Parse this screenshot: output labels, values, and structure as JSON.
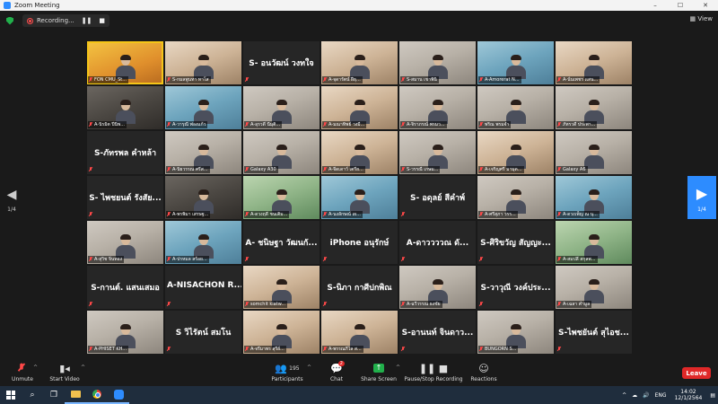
{
  "window": {
    "title": "Zoom Meeting",
    "controls": [
      "–",
      "☐",
      "✕"
    ]
  },
  "topbar": {
    "recording_label": "Recording...",
    "pause_glyph": "❚❚",
    "stop_glyph": "■",
    "view_label": "View"
  },
  "pagination": {
    "left_page": "1/4",
    "right_page": "1/4"
  },
  "tiles": [
    [
      {
        "type": "active",
        "label": "FON CMU_St..."
      },
      {
        "type": "video",
        "tone": "warm",
        "label": "S-กมลพูนทา ทาโส"
      },
      {
        "type": "name",
        "text": "S- อนวัฒน์ วงทใจ"
      },
      {
        "type": "video",
        "tone": "warm",
        "label": "A-จุดารัตน์ ฝีธุ..."
      },
      {
        "type": "video",
        "tone": "",
        "label": "S-สมาน เขาพินิ"
      },
      {
        "type": "video",
        "tone": "blue",
        "label": "A-Amorerat N..."
      },
      {
        "type": "video",
        "tone": "warm",
        "label": "A-นั่นเพชร เเสน..."
      }
    ],
    [
      {
        "type": "video",
        "tone": "dark",
        "label": "A-นิรมิต ปีนิพ..."
      },
      {
        "type": "video",
        "tone": "blue",
        "label": "A-วารุณี พ่องแก้ว"
      },
      {
        "type": "video",
        "tone": "",
        "label": "A-อุรวดี นีมุติ..."
      },
      {
        "type": "video",
        "tone": "warm",
        "label": "A-มณาทิพย์ วงมี..."
      },
      {
        "type": "video",
        "tone": "",
        "label": "A-จิราภรณ์ พรมว..."
      },
      {
        "type": "video",
        "tone": "",
        "label": "พริณ พรมจำ"
      },
      {
        "type": "video",
        "tone": "",
        "label": "ภัทรวดี ประพา..."
      }
    ],
    [
      {
        "type": "name",
        "text": "S-ภัทรพล คำหล้า"
      },
      {
        "type": "video",
        "tone": "",
        "label": "A-นิยวรรณ ศรีส..."
      },
      {
        "type": "video",
        "tone": "",
        "label": "Galaxy A30"
      },
      {
        "type": "video",
        "tone": "warm",
        "label": "A-จีดเดาว์ เตรีย..."
      },
      {
        "type": "video",
        "tone": "",
        "label": "S-วรรณี เกษม..."
      },
      {
        "type": "video",
        "tone": "warm",
        "label": "A-เจริญศรี มามุด..."
      },
      {
        "type": "video",
        "tone": "",
        "label": "Galaxy A6"
      }
    ],
    [
      {
        "type": "name",
        "text": "S- ไพชยนต์ รังสัย..."
      },
      {
        "type": "video",
        "tone": "dark",
        "label": "A-พรพิมา เสรษฐ..."
      },
      {
        "type": "video",
        "tone": "green",
        "label": "A-ดวงฤดี ชนเติม..."
      },
      {
        "type": "video",
        "tone": "blue",
        "label": "A-นงลักษณ์ เผ..."
      },
      {
        "type": "name",
        "text": "S- อดุลย์ สีคำพ์"
      },
      {
        "type": "video",
        "tone": "",
        "label": "A-ศรีสุภา วรร..."
      },
      {
        "type": "video",
        "tone": "blue",
        "label": "A-ดวงเพ็ญ ณ นุ..."
      }
    ],
    [
      {
        "type": "video",
        "tone": "",
        "label": "A-สุวิช จิ่นทอง"
      },
      {
        "type": "video",
        "tone": "blue",
        "label": "A-ปรหมล สร้อย..."
      },
      {
        "type": "name",
        "text": "A- ชนิษฐา วัฒนกั..."
      },
      {
        "type": "name",
        "text": "iPhone อนุรักษ์"
      },
      {
        "type": "name",
        "text": "A-ดาววววณ ดั..."
      },
      {
        "type": "name",
        "text": "S-ศิริขวัญ สัญญะ..."
      },
      {
        "type": "video",
        "tone": "green",
        "label": "A-สมปลี สกุลพ..."
      }
    ],
    [
      {
        "type": "name",
        "text": "S-กานต์. แสนเสมอ"
      },
      {
        "type": "name",
        "text": "A-NISACHON R..."
      },
      {
        "type": "video",
        "tone": "warm",
        "label": "somchit kiatw..."
      },
      {
        "type": "name",
        "text": "S-นิภา กาศีปกพิณ"
      },
      {
        "type": "video",
        "tone": "",
        "label": "A-ฉวีวรรณ ธงชัย"
      },
      {
        "type": "name",
        "text": "S-วาวุณี วงค์ประ..."
      },
      {
        "type": "video",
        "tone": "",
        "label": "A-เฉลา คำมูล"
      }
    ],
    [
      {
        "type": "video",
        "tone": "",
        "label": "A-PHISET KH..."
      },
      {
        "type": "name",
        "text": "S วิไรัตน์ สมโน"
      },
      {
        "type": "video",
        "tone": "warm",
        "label": "A-จรีมาพร สุรีย์..."
      },
      {
        "type": "video",
        "tone": "warm",
        "label": "A-พรรณภิไล ส..."
      },
      {
        "type": "name",
        "text": "S-อานนท์ จินดาว..."
      },
      {
        "type": "video",
        "tone": "",
        "label": "BUNGORN S..."
      },
      {
        "type": "name",
        "text": "S-ไพชยันต์ สุไอช..."
      }
    ]
  ],
  "controls": {
    "unmute": "Unmute",
    "start_video": "Start Video",
    "participants": "Participants",
    "participants_count": "195",
    "chat": "Chat",
    "chat_badge": "2",
    "share_screen": "Share Screen",
    "record": "Pause/Stop Recording",
    "reactions": "Reactions",
    "leave": "Leave"
  },
  "taskbar": {
    "lang": "ENG",
    "time": "14:02",
    "date": "12/1/2564"
  },
  "colors": {
    "accent": "#2d8cff",
    "share": "#21b04b",
    "leave": "#e02828",
    "speaker_outline": "#f5c518"
  }
}
